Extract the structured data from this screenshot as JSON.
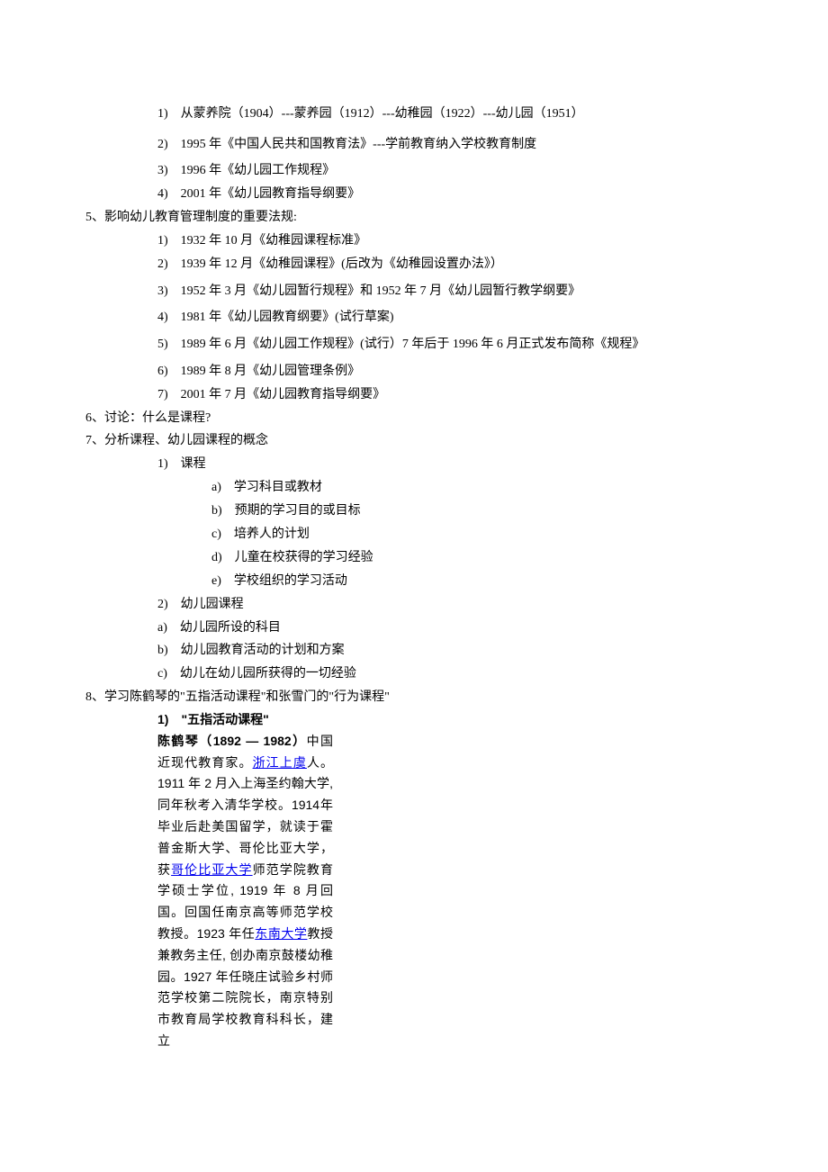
{
  "lines": [
    {
      "cls": "l2 gap",
      "text": "1)　从蒙养院（1904）---蒙养园（1912）---幼稚园（1922）---幼儿园（1951）"
    },
    {
      "cls": "l2 gap",
      "text": "2)　1995 年《中国人民共和国教育法》---学前教育纳入学校教育制度"
    },
    {
      "cls": "l2",
      "text": "3)　1996 年《幼儿园工作规程》"
    },
    {
      "cls": "l2",
      "text": "4)　2001 年《幼儿园教育指导纲要》"
    },
    {
      "cls": "l0",
      "text": "5、影响幼儿教育管理制度的重要法规:"
    },
    {
      "cls": "l2",
      "text": "1)　1932 年 10 月《幼稚园课程标准》"
    },
    {
      "cls": "l2",
      "text": "2)　1939 年 12 月《幼稚园课程》(后改为《幼稚园设置办法》）"
    },
    {
      "cls": "l2 gap",
      "text": "3)　1952 年 3 月《幼儿园暂行规程》和 1952 年 7 月《幼儿园暂行教学纲要》"
    },
    {
      "cls": "l2",
      "text": "4)　1981 年《幼儿园教育纲要》(试行草案)"
    },
    {
      "cls": "l2 gap",
      "text": "5)　1989 年 6 月《幼儿园工作规程》(试行）7 年后于 1996 年 6 月正式发布简称《规程》"
    },
    {
      "cls": "l2",
      "text": "6)　1989 年 8 月《幼儿园管理条例》"
    },
    {
      "cls": "l2",
      "text": "7)　2001 年 7 月《幼儿园教育指导纲要》"
    },
    {
      "cls": "l0",
      "text": "6、讨论：什么是课程?"
    },
    {
      "cls": "l0",
      "text": "7、分析课程、幼儿园课程的概念"
    },
    {
      "cls": "l2",
      "text": "1)　课程"
    },
    {
      "cls": "l3",
      "text": "a)　学习科目或教材"
    },
    {
      "cls": "l3",
      "text": "b)　预期的学习目的或目标"
    },
    {
      "cls": "l3",
      "text": "c)　培养人的计划"
    },
    {
      "cls": "l3",
      "text": "d)　儿童在校获得的学习经验"
    },
    {
      "cls": "l3",
      "text": "e)　学校组织的学习活动"
    },
    {
      "cls": "l2",
      "text": "2)　幼儿园课程"
    },
    {
      "cls": "l2",
      "text": "a)　幼儿园所设的科目"
    },
    {
      "cls": "l2",
      "text": "b)　幼儿园教育活动的计划和方案"
    },
    {
      "cls": "l2",
      "text": "c)　幼儿在幼儿园所获得的一切经验"
    },
    {
      "cls": "l0",
      "text": "8、学习陈鹤琴的\"五指活动课程\"和张雪门的\"行为课程\""
    }
  ],
  "narrow": {
    "heading": "1)　\"五指活动课程\"",
    "name_prefix": "陈鹤琴（1892 — 1982）",
    "name_suffix": "中国",
    "p1_a": "近现代教育家。",
    "link1": "浙江上虞",
    "p1_b": "人。",
    "p2": "1911 年 2 月入上海圣约翰大学, 同年秋考入清华学校。1914年毕业后赴美国留学，就读于霍普金斯大学、哥伦比亚大学，获",
    "link2": "哥伦比亚大学",
    "p2_b": "师范学院教育学硕士学位, 1919 年 8 月回国。回国任南京高等师范学校教授。1923 年任",
    "link3": "东南大学",
    "p2_c": "教授兼教务主任, 创办南京鼓楼幼稚园。1927 年任晓庄试验乡村师范学校第二院院长，南京特别市教育局学校教育科科长，建立"
  }
}
